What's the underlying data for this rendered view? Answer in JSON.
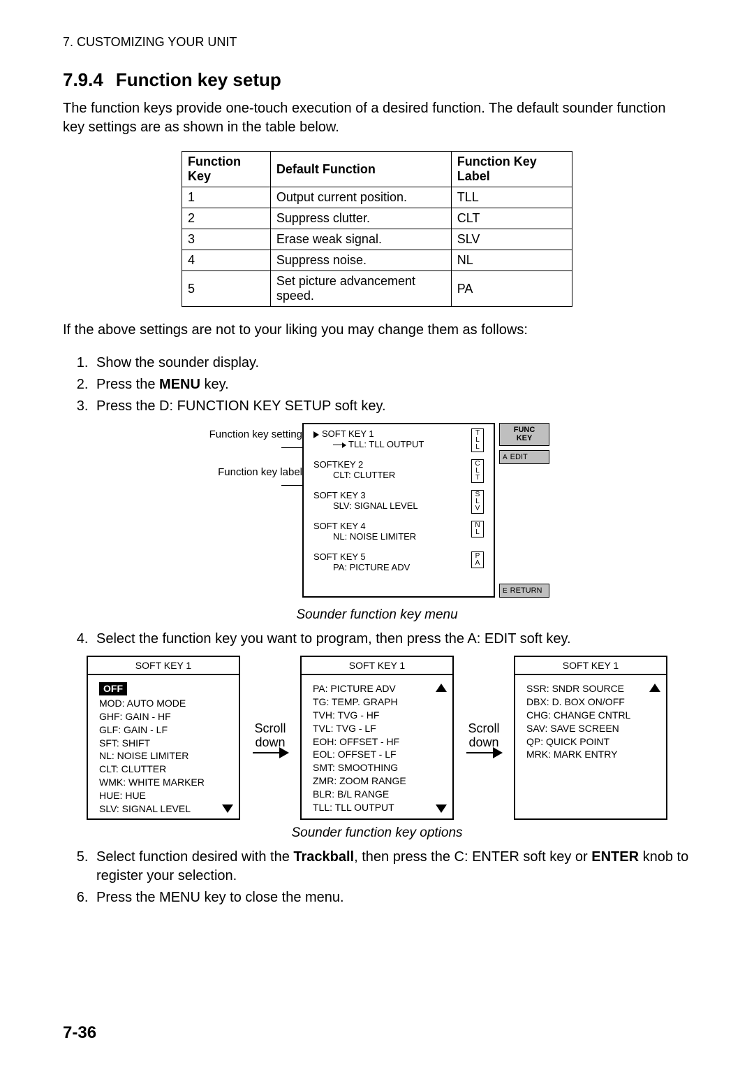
{
  "header": {
    "chapter_line": "7.  CUSTOMIZING YOUR UNIT",
    "section_number": "7.9.4",
    "section_title": "Function key setup"
  },
  "intro_paragraph": "The function keys provide one-touch execution of a desired function. The default sounder function key settings are as shown in the table below.",
  "fk_table": {
    "headers": [
      "Function Key",
      "Default Function",
      "Function Key Label"
    ],
    "rows": [
      [
        "1",
        "Output current position.",
        "TLL"
      ],
      [
        "2",
        "Suppress clutter.",
        "CLT"
      ],
      [
        "3",
        "Erase weak signal.",
        "SLV"
      ],
      [
        "4",
        "Suppress noise.",
        "NL"
      ],
      [
        "5",
        "Set picture advancement speed.",
        "PA"
      ]
    ]
  },
  "after_table_paragraph": "If the above settings are not to your liking you may change them as follows:",
  "steps_first": [
    "Show the sounder display.",
    "Press the <b>MENU</b> key.",
    "Press the D: FUNCTION KEY SETUP soft key."
  ],
  "annotations": {
    "a1": "Function key setting",
    "a2": "Function key label"
  },
  "menu": {
    "rows": [
      {
        "title": "SOFT KEY 1",
        "sub": "TLL: TLL OUTPUT",
        "mini": "T\nL\nL",
        "first": true
      },
      {
        "title": "SOFTKEY 2",
        "sub": "CLT: CLUTTER",
        "mini": "C\nL\nT"
      },
      {
        "title": "SOFT KEY 3",
        "sub": "SLV: SIGNAL LEVEL",
        "mini": "S\nL\nV"
      },
      {
        "title": "SOFT KEY 4",
        "sub": "NL: NOISE LIMITER",
        "mini": "N\nL"
      },
      {
        "title": "SOFT KEY 5",
        "sub": "PA: PICTURE ADV",
        "mini": "P\nA"
      }
    ],
    "side": {
      "func_l1": "FUNC",
      "func_l2": "KEY",
      "edit_letter": "A",
      "edit_label": "EDIT",
      "return_letter": "E",
      "return_label": "RETURN"
    }
  },
  "caption1": "Sounder function key menu",
  "step4": "Select the function key you want to program, then press the A: EDIT soft key.",
  "option_panels": [
    {
      "header": "SOFT KEY 1",
      "show_off": true,
      "show_up": false,
      "show_down": true,
      "items": [
        "MOD: AUTO MODE",
        "GHF: GAIN - HF",
        "GLF: GAIN - LF",
        "SFT: SHIFT",
        "NL: NOISE LIMITER",
        "CLT: CLUTTER",
        "WMK: WHITE MARKER",
        "HUE: HUE",
        "SLV: SIGNAL LEVEL"
      ]
    },
    {
      "header": "SOFT KEY 1",
      "show_off": false,
      "show_up": true,
      "show_down": true,
      "items": [
        "PA: PICTURE ADV",
        "TG: TEMP. GRAPH",
        "TVH: TVG - HF",
        "TVL: TVG - LF",
        "EOH: OFFSET - HF",
        "EOL: OFFSET - LF",
        "SMT: SMOOTHING",
        "ZMR: ZOOM RANGE",
        "BLR: B/L RANGE",
        "TLL: TLL OUTPUT"
      ]
    },
    {
      "header": "SOFT KEY 1",
      "show_off": false,
      "show_up": true,
      "show_down": false,
      "items": [
        "SSR: SNDR SOURCE",
        "DBX: D. BOX ON/OFF",
        "CHG: CHANGE CNTRL",
        "SAV: SAVE SCREEN",
        "QP: QUICK POINT",
        "MRK: MARK ENTRY"
      ]
    }
  ],
  "scroll_label": "Scroll down",
  "caption2": "Sounder function key options",
  "steps_last": [
    "Select function desired with the <b>Trackball</b>, then press the C: ENTER soft key or <b>ENTER</b> knob to register your selection.",
    "Press the MENU key to close the menu."
  ],
  "page_number": "7-36",
  "off_label": "OFF"
}
